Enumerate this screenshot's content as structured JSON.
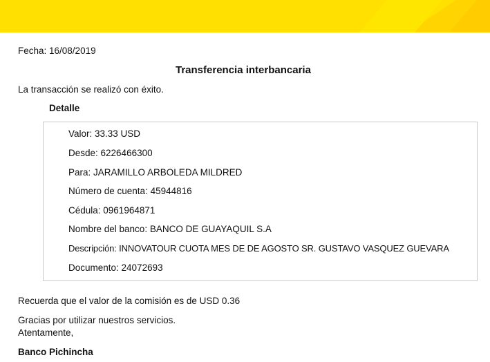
{
  "header": {
    "brand_color": "#ffe000"
  },
  "document": {
    "fecha": "Fecha: 16/08/2019",
    "title": "Transferencia interbancaria",
    "status": "La transacción se realizó con éxito.",
    "detail_heading": "Detalle",
    "details": [
      "Valor: 33.33 USD",
      "Desde: 6226466300",
      "Para: JARAMILLO ARBOLEDA MILDRED",
      "Número de cuenta: 45944816",
      "Cédula: 0961964871",
      "Nombre del banco: BANCO DE GUAYAQUIL S.A",
      "Descripción: INNOVATOUR CUOTA MES DE DE AGOSTO SR. GUSTAVO VASQUEZ GUEVARA",
      "Documento: 24072693"
    ],
    "commission_note": "Recuerda que el valor de la comisión es de USD 0.36",
    "thanks": "Gracias por utilizar nuestros servicios.",
    "closing": "Atentamente,",
    "signature": "Banco Pichincha"
  }
}
